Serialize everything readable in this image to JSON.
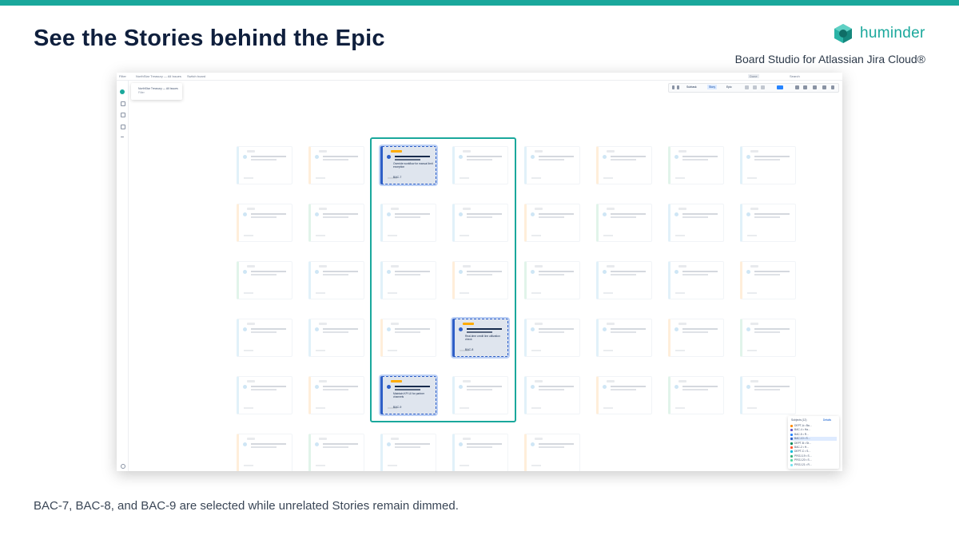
{
  "slide": {
    "title": "See the Stories behind the Epic",
    "subtitle": "Board Studio for Atlassian Jira Cloud®",
    "caption": "BAC-7, BAC-8, and BAC-9 are selected while unrelated Stories remain dimmed."
  },
  "brand": {
    "name": "huminder",
    "accent": "#1aa89c"
  },
  "app": {
    "top_menu": [
      "Filter",
      "NorthStar Treasury — All Issues",
      "Switch board"
    ],
    "top_right": [
      "Done",
      "Search"
    ],
    "filter_popup": {
      "title": "NorthStar Treasury — All Issues",
      "subtitle": "Filter"
    },
    "toolbar": {
      "subtasks": "Subtask",
      "story": "Story",
      "epic": "Epic"
    },
    "selected_cards": [
      {
        "key": "BAC-7",
        "title": "Override workflow for manual limit exception"
      },
      {
        "key": "BAC-8",
        "title": "Real-time credit line utilization check"
      },
      {
        "key": "BAC-9",
        "title": "Maintain KPI UI for partner channels"
      }
    ],
    "legend": {
      "header": "Subjects (12)",
      "action": "Details",
      "rows": [
        {
          "name": "DEPT-A • Ba…",
          "color": "#ff8b00"
        },
        {
          "name": "BAC-4 • Ha…",
          "color": "#6554c0"
        },
        {
          "name": "BAC-5 • R…",
          "color": "#2684ff"
        },
        {
          "name": "BAC-10 • S…",
          "color": "#2e5fc7"
        },
        {
          "name": "DEPT-B • St…",
          "color": "#00875a"
        },
        {
          "name": "BAC-2 • H…",
          "color": "#ff5630"
        },
        {
          "name": "DEPT-C • S…",
          "color": "#00b8d9"
        },
        {
          "name": "PROJ-19 • S…",
          "color": "#36b37e"
        },
        {
          "name": "PROJ-20 • S…",
          "color": "#57d9a3"
        },
        {
          "name": "PROJ-21 • R…",
          "color": "#79e2f2"
        }
      ]
    }
  }
}
